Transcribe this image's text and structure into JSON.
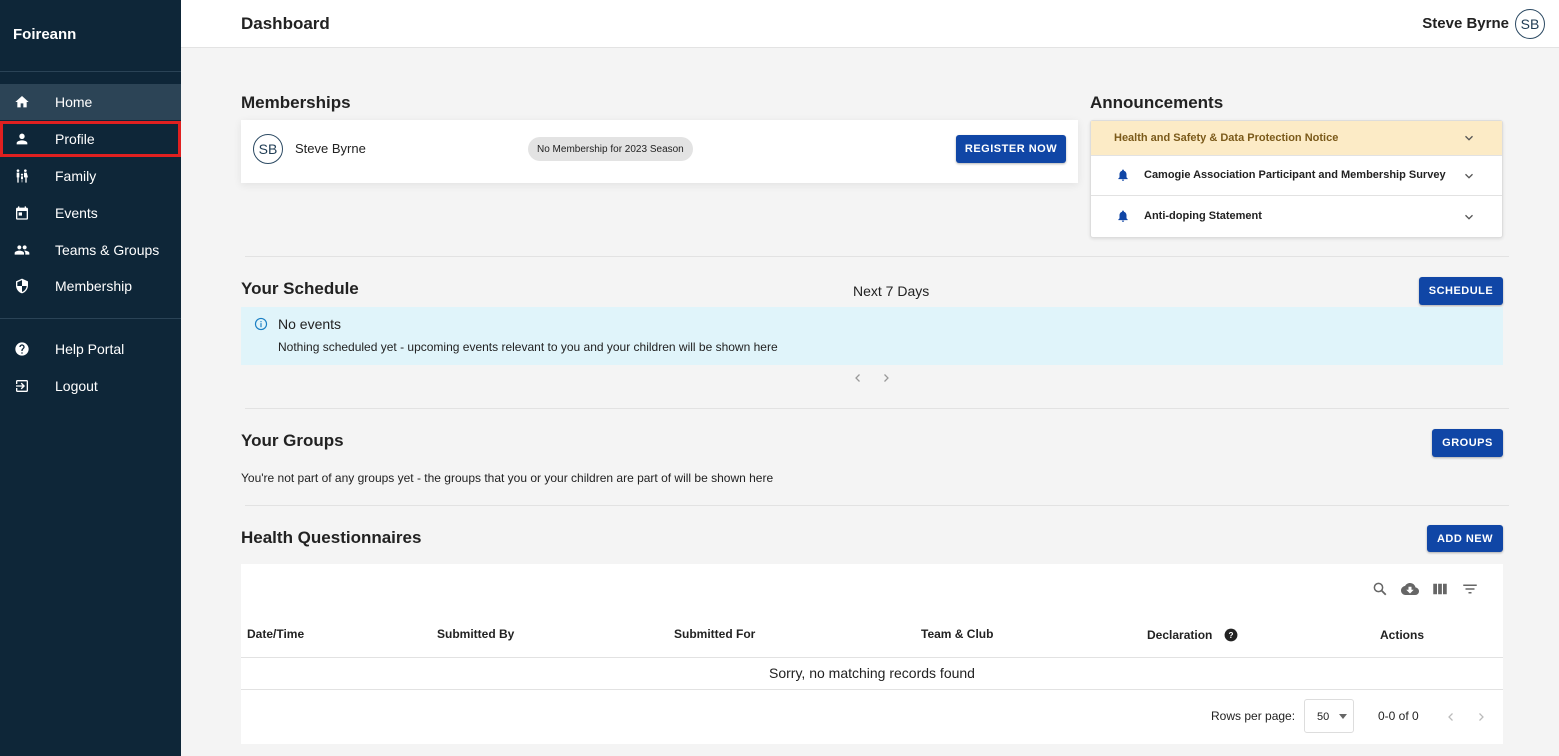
{
  "sidebar": {
    "brand": "Foireann",
    "items": [
      {
        "label": "Home",
        "icon": "home-icon"
      },
      {
        "label": "Profile",
        "icon": "person-icon"
      },
      {
        "label": "Family",
        "icon": "family-icon"
      },
      {
        "label": "Events",
        "icon": "calendar-icon"
      },
      {
        "label": "Teams & Groups",
        "icon": "people-icon"
      },
      {
        "label": "Membership",
        "icon": "shield-icon"
      }
    ],
    "secondary": [
      {
        "label": "Help Portal",
        "icon": "help-icon"
      },
      {
        "label": "Logout",
        "icon": "logout-icon"
      }
    ]
  },
  "header": {
    "title": "Dashboard",
    "user_name": "Steve Byrne",
    "user_initials": "SB"
  },
  "memberships": {
    "title": "Memberships",
    "initials": "SB",
    "name": "Steve Byrne",
    "status": "No Membership for 2023 Season",
    "register_label": "REGISTER NOW"
  },
  "announcements": {
    "title": "Announcements",
    "items": [
      {
        "label": "Health and Safety & Data Protection Notice"
      },
      {
        "label": "Camogie Association Participant and Membership Survey"
      },
      {
        "label": "Anti-doping Statement"
      }
    ]
  },
  "schedule": {
    "title": "Your Schedule",
    "range": "Next 7 Days",
    "button_label": "SCHEDULE",
    "empty_title": "No events",
    "empty_body": "Nothing scheduled yet - upcoming events relevant to you and your children will be shown here"
  },
  "groups": {
    "title": "Your Groups",
    "button_label": "GROUPS",
    "empty_text": "You're not part of any groups yet - the groups that you or your children are part of will be shown here"
  },
  "questionnaires": {
    "title": "Health Questionnaires",
    "button_label": "ADD NEW",
    "columns": [
      "Date/Time",
      "Submitted By",
      "Submitted For",
      "Team & Club",
      "Declaration",
      "Actions"
    ],
    "empty_text": "Sorry, no matching records found",
    "rows_per_page_label": "Rows per page:",
    "rows_per_page": "50",
    "range": "0-0 of 0"
  },
  "colors": {
    "sidebar_bg": "#0e2638",
    "primary": "#1046a6",
    "notice_bg": "#fcebc6",
    "info_bg": "#e0f4fa"
  }
}
